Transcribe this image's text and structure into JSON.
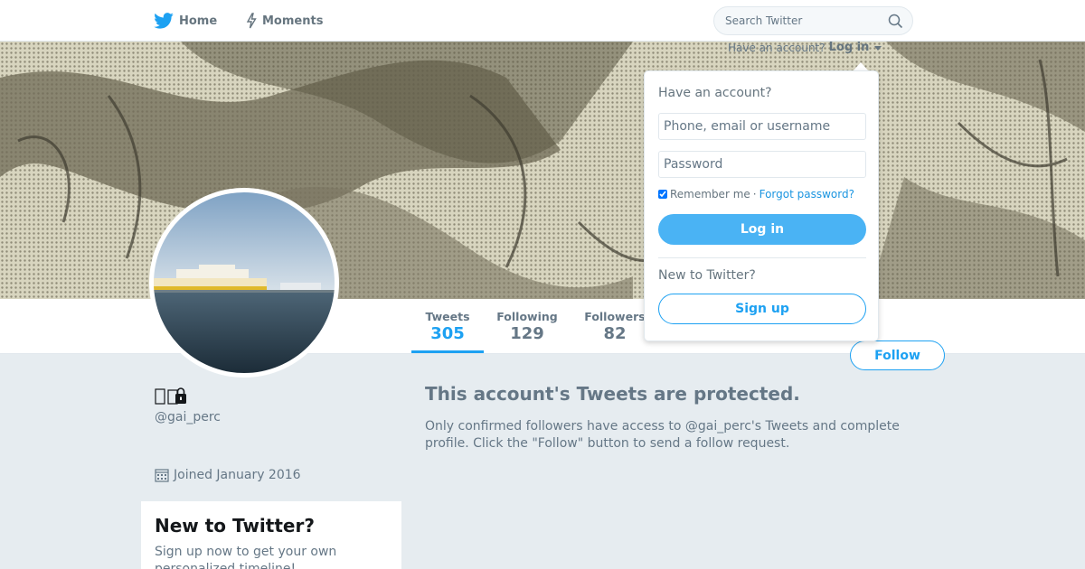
{
  "nav": {
    "home_label": "Home",
    "moments_label": "Moments",
    "search_placeholder": "Search Twitter"
  },
  "header": {
    "have_account": "Have an account?",
    "login_link": "Log in"
  },
  "stats": {
    "tweets_label": "Tweets",
    "tweets_value": "305",
    "following_label": "Following",
    "following_value": "129",
    "followers_label": "Followers",
    "followers_value": "82"
  },
  "follow_label": "Follow",
  "profile": {
    "screen_name": "@gai_perc",
    "joined": "Joined January 2016"
  },
  "signup_card": {
    "title": "New to Twitter?",
    "text": "Sign up now to get your own personalized timeline!"
  },
  "protected": {
    "title": "This account's Tweets are protected.",
    "text": "Only confirmed followers have access to @gai_perc's Tweets and complete profile. Click the \"Follow\" button to send a follow request."
  },
  "login_dropdown": {
    "heading": "Have an account?",
    "username_placeholder": "Phone, email or username",
    "password_placeholder": "Password",
    "remember_label": "Remember me",
    "separator": "·",
    "forgot_label": "Forgot password?",
    "login_button": "Log in",
    "new_label": "New to Twitter?",
    "signup_button": "Sign up"
  },
  "colors": {
    "accent": "#1da1f2",
    "background": "#e6ecf0"
  },
  "icons": [
    "twitter-bird-icon",
    "moments-bolt-icon",
    "search-icon",
    "protected-lock-icon",
    "calendar-icon",
    "checkbox-icon"
  ]
}
